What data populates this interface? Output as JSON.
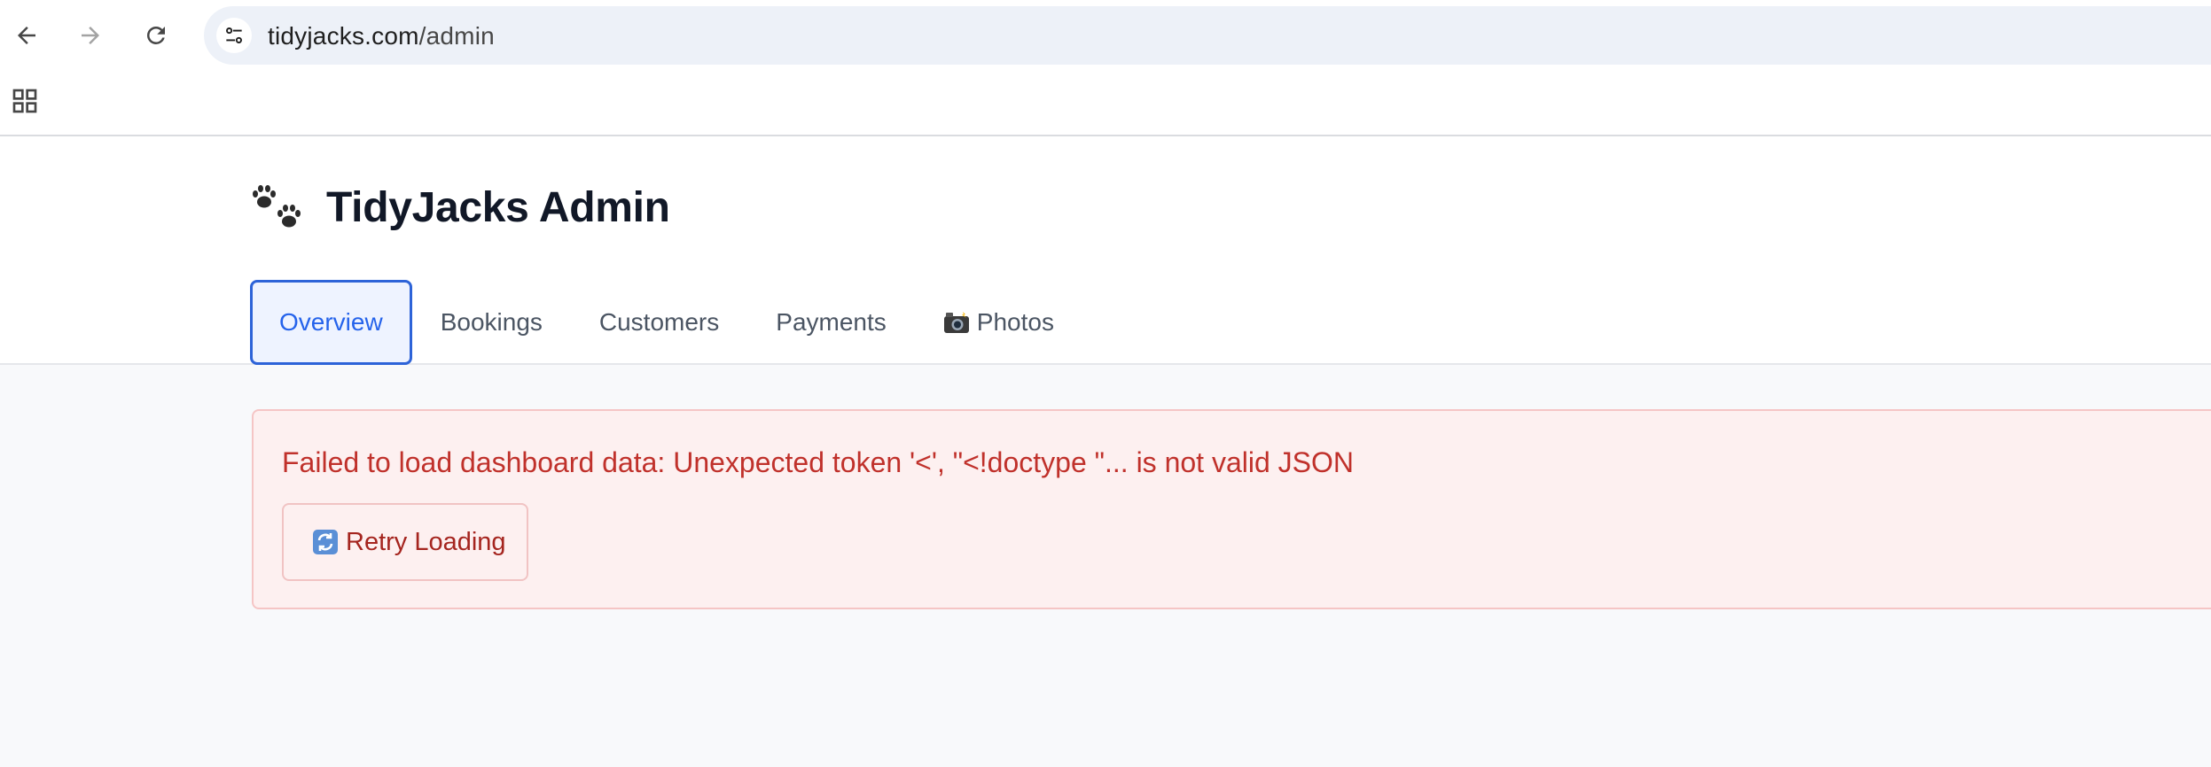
{
  "browser": {
    "url_domain": "tidyjacks.com",
    "url_path": "/admin"
  },
  "app": {
    "title": "TidyJacks Admin",
    "logo_icon": "paw-prints-icon",
    "accent_color": "#2563eb"
  },
  "tabs": [
    {
      "label": "Overview",
      "active": true
    },
    {
      "label": "Bookings",
      "active": false
    },
    {
      "label": "Customers",
      "active": false
    },
    {
      "label": "Payments",
      "active": false
    },
    {
      "label": "Photos",
      "active": false,
      "icon": "camera-flash-icon"
    }
  ],
  "error": {
    "message": "Failed to load dashboard data: Unexpected token '<', \"<!doctype \"... is not valid JSON",
    "retry_label": "Retry Loading",
    "retry_icon": "refresh-icon",
    "text_color": "#c0312b",
    "background_color": "#fdf0f0"
  }
}
